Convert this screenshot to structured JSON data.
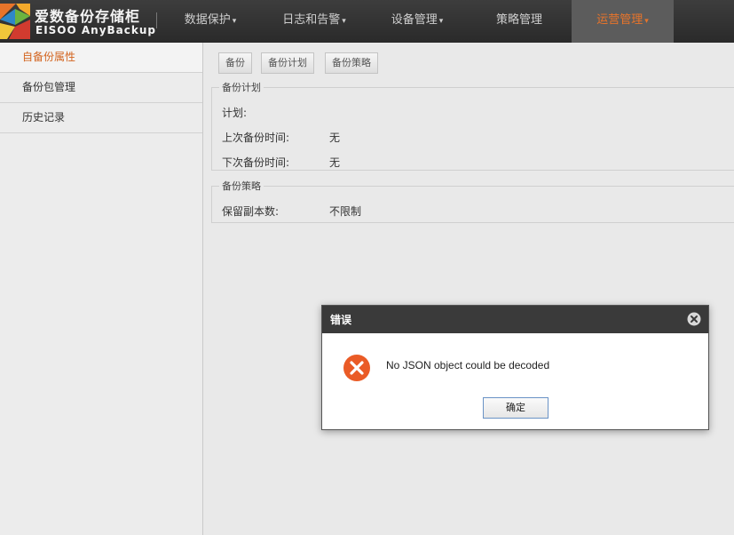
{
  "app": {
    "logo_cn": "爱数备份存储柜",
    "logo_en": "EISOO AnyBackup"
  },
  "nav": {
    "items": [
      {
        "label": "数据保护",
        "caret": "▾"
      },
      {
        "label": "日志和告警",
        "caret": "▾"
      },
      {
        "label": "设备管理",
        "caret": "▾"
      },
      {
        "label": "策略管理",
        "caret": ""
      },
      {
        "label": "运营管理",
        "caret": "▾",
        "active": true
      }
    ]
  },
  "sidebar": {
    "items": [
      {
        "label": "自备份属性",
        "active": true
      },
      {
        "label": "备份包管理"
      },
      {
        "label": "历史记录"
      }
    ]
  },
  "tabs": [
    {
      "label": "备份"
    },
    {
      "label": "备份计划"
    },
    {
      "label": "备份策略"
    }
  ],
  "plan_section": {
    "title": "备份计划",
    "plan_label": "计划:",
    "last_label": "上次备份时间:",
    "last_value": "无",
    "next_label": "下次备份时间:",
    "next_value": "无"
  },
  "policy_section": {
    "title": "备份策略",
    "retain_label": "保留副本数:",
    "retain_value": "不限制"
  },
  "dialog": {
    "title": "错误",
    "message": "No JSON object could be decoded",
    "ok_label": "确定",
    "icon": "error-x-icon",
    "close_icon": "close-icon"
  },
  "colors": {
    "accent": "#e8742a",
    "error": "#ea5b26",
    "topbar": "#333333"
  }
}
